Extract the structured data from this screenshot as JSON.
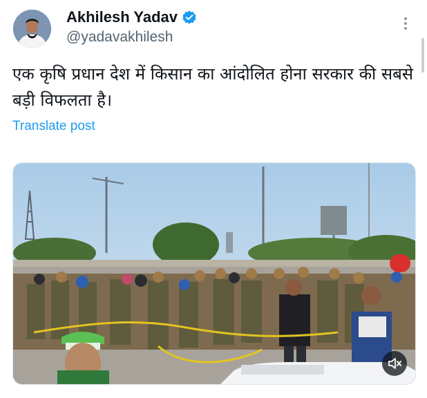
{
  "author": {
    "display_name": "Akhilesh Yadav",
    "handle": "@yadavakhilesh",
    "verified": true
  },
  "post": {
    "text": "एक कृषि प्रधान देश में किसान का आंदोलित होना सरकार की सबसे बड़ी विफलता है।",
    "translate_label": "Translate post"
  },
  "media": {
    "type": "video",
    "muted": true
  },
  "icons": {
    "verified": "verified-badge-icon",
    "more": "more-options-icon",
    "mute": "volume-muted-icon"
  },
  "colors": {
    "link": "#1d9bf0",
    "verified": "#1d9bf0",
    "secondary_text": "#536471"
  }
}
